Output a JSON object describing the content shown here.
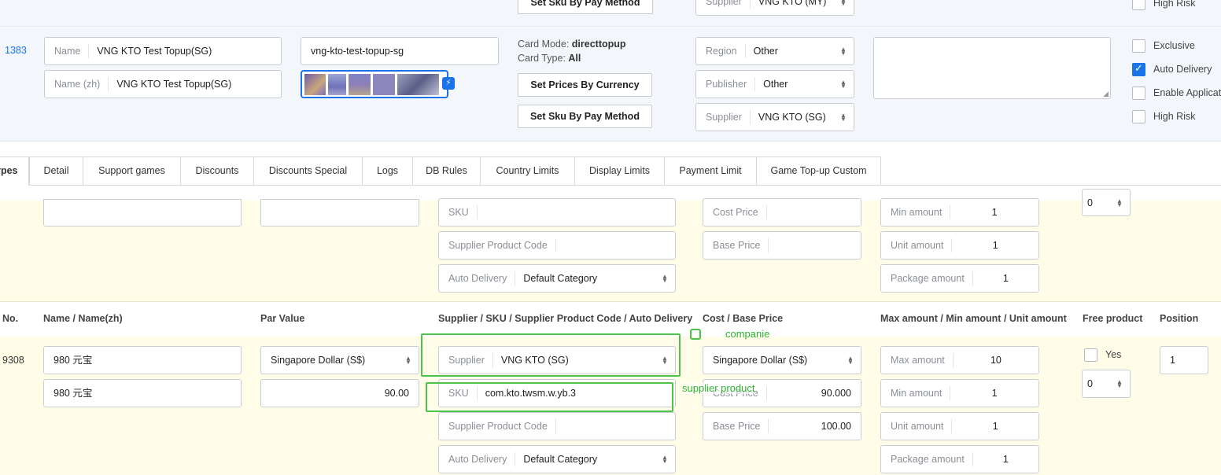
{
  "top_row": {
    "set_sku_btn": "Set Sku By Pay Method",
    "supplier_label": "Supplier",
    "supplier_value": "VNG KTO (MY)",
    "high_risk": "High Risk"
  },
  "product_row": {
    "id": "1383",
    "name_label": "Name",
    "name_value": "VNG KTO Test Topup(SG)",
    "name_zh_label": "Name (zh)",
    "name_zh_value": "VNG KTO Test Topup(SG)",
    "slug": "vng-kto-test-topup-sg",
    "card_mode_label": "Card Mode:",
    "card_mode_value": "directtopup",
    "card_type_label": "Card Type:",
    "card_type_value": "All",
    "set_prices_btn": "Set Prices By Currency",
    "set_sku_btn": "Set Sku By Pay Method",
    "region_label": "Region",
    "region_value": "Other",
    "publisher_label": "Publisher",
    "publisher_value": "Other",
    "supplier_label": "Supplier",
    "supplier_value": "VNG KTO (SG)",
    "checkboxes": [
      {
        "label": "Exclusive",
        "checked": false
      },
      {
        "label": "Auto Delivery",
        "checked": true
      },
      {
        "label": "Enable Applicat",
        "checked": false
      },
      {
        "label": "High Risk",
        "checked": false
      }
    ]
  },
  "tabs": [
    "ypes",
    "Detail",
    "Support games",
    "Discounts",
    "Discounts Special",
    "Logs",
    "DB Rules",
    "Country Limits",
    "Display Limits",
    "Payment Limit",
    "Game Top-up Custom"
  ],
  "row1": {
    "sku_label": "SKU",
    "spc_label": "Supplier Product Code",
    "auto_delivery_label": "Auto Delivery",
    "auto_delivery_value": "Default Category",
    "cost_label": "Cost Price",
    "base_label": "Base Price",
    "min_label": "Min amount",
    "min_value": "1",
    "unit_label": "Unit amount",
    "unit_value": "1",
    "pkg_label": "Package amount",
    "pkg_value": "1",
    "position_value": "0"
  },
  "headers": {
    "no": "No.",
    "name": "Name / Name(zh)",
    "par": "Par Value",
    "supplier": "Supplier / SKU / Supplier Product Code / Auto Delivery",
    "cost": "Cost / Base Price",
    "amounts": "Max amount / Min amount / Unit amount",
    "free": "Free product",
    "position": "Position"
  },
  "row2": {
    "no": "9308",
    "name": "980 元宝",
    "name_zh": "980 元宝",
    "currency": "Singapore Dollar (S$)",
    "par_value": "90.00",
    "supplier_label": "Supplier",
    "supplier_value": "VNG KTO (SG)",
    "sku_label": "SKU",
    "sku_value": "com.kto.twsm.w.yb.3",
    "spc_label": "Supplier Product Code",
    "auto_delivery_label": "Auto Delivery",
    "auto_delivery_value": "Default Category",
    "cost_currency": "Singapore Dollar (S$)",
    "cost_label": "Cost Price",
    "cost_value": "90.000",
    "base_label": "Base Price",
    "base_value": "100.00",
    "max_label": "Max amount",
    "max_value": "10",
    "min_label": "Min amount",
    "min_value": "1",
    "unit_label": "Unit amount",
    "unit_value": "1",
    "pkg_label": "Package amount",
    "pkg_value": "1",
    "free_yes": "Yes",
    "free_qty": "0",
    "position": "1"
  },
  "annotations": {
    "companie": "companie",
    "supplier_product": "supplier product"
  },
  "colors": {
    "accent": "#1a73e8",
    "annotation_green": "#4dc24d",
    "yellow_bg": "#fffde7",
    "blue_bg": "#f3f7fc"
  }
}
